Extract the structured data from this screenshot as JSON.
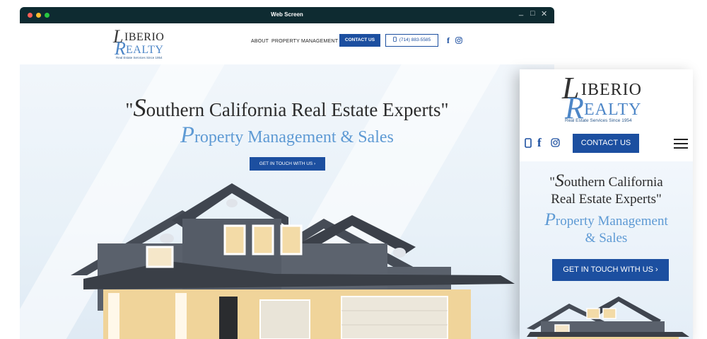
{
  "window": {
    "title": "Web Screen"
  },
  "logo": {
    "initial_1": "L",
    "rest_1": "IBERIO",
    "initial_2": "R",
    "rest_2": "EALTY",
    "tagline": "Real Estate Services Since 1954"
  },
  "nav": {
    "about": "ABOUT",
    "property_management": "PROPERTY MANAGEMENT",
    "contact": "CONTACT US",
    "phone": "(714) 883-5585"
  },
  "hero": {
    "quote_open": "\"",
    "quote_initial": "S",
    "quote_rest": "outhern California Real Estate Experts\"",
    "sub_initial": "P",
    "sub_rest": "roperty Management & Sales",
    "cta": "GET IN TOUCH WITH US  ›"
  },
  "mobile": {
    "contact": "CONTACT US",
    "line1_open": "\"",
    "line1_initial": "S",
    "line1_rest": "outhern California",
    "line2": "Real Estate Experts\"",
    "line3_initial": "P",
    "line3_rest": "roperty Management",
    "line4": "& Sales",
    "cta": "GET IN TOUCH WITH US  ›"
  },
  "colors": {
    "brand_blue": "#1c4fa0",
    "accent_blue": "#5e9ad4",
    "titlebar": "#0e2b31"
  },
  "icons": [
    "phone-icon",
    "facebook-icon",
    "instagram-icon",
    "hamburger-menu-icon"
  ]
}
